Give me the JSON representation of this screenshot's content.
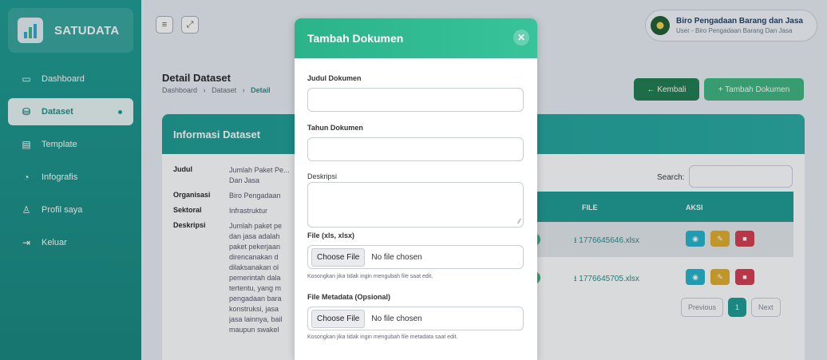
{
  "brand": {
    "name": "SATUDATA"
  },
  "sidebar": {
    "items": [
      {
        "label": "Dashboard",
        "icon": "monitor-icon"
      },
      {
        "label": "Dataset",
        "icon": "database-icon",
        "active": true
      },
      {
        "label": "Template",
        "icon": "document-icon"
      },
      {
        "label": "Infografis",
        "icon": "pie-chart-icon"
      },
      {
        "label": "Profil saya",
        "icon": "user-icon"
      },
      {
        "label": "Keluar",
        "icon": "logout-icon"
      }
    ]
  },
  "topbar": {
    "menu_icon": "≡",
    "expand_icon": "⤢",
    "profile": {
      "name": "Biro Pengadaan Barang dan Jasa",
      "role": "User - Biro Pengadaan Barang Dan Jasa"
    }
  },
  "page": {
    "title": "Detail Dataset",
    "breadcrumb": [
      "Dashboard",
      "Dataset",
      "Detail"
    ],
    "breadcrumb_sep": "›",
    "back_button": "← Kembali",
    "add_button": "+ Tambah Dokumen"
  },
  "info": {
    "header": "Informasi Dataset",
    "rows": [
      {
        "key": "Judul",
        "value": "Jumlah Paket Pe... Dan Jasa"
      },
      {
        "key": "Organisasi",
        "value": "Biro Pengadaan"
      },
      {
        "key": "Sektoral",
        "value": "Infrastruktur"
      },
      {
        "key": "Deskripsi",
        "value": "Jumlah paket pe dan jasa adalah paket pekerjaan direncanakan d dilaksanakan ol pemerintah dala tertentu, yang m pengadaan bara konstruksi, jasa jasa lainnya, bail maupun swakel"
      }
    ]
  },
  "table": {
    "search_label": "Search:",
    "columns": [
      "FILE",
      "AKSI"
    ],
    "rows": [
      {
        "file": "⭳ 1776645646.xlsx"
      },
      {
        "file": "⭳ 1776645705.xlsx"
      }
    ],
    "pager": {
      "prev": "Previous",
      "page": "1",
      "next": "Next"
    }
  },
  "modal": {
    "title": "Tambah Dokumen",
    "close": "✕",
    "fields": {
      "judul_label": "Judul Dokumen",
      "tahun_label": "Tahun Dokumen",
      "deskripsi_label": "Deskripsi",
      "file_label": "File (xls, xlsx)",
      "file_button": "Choose File",
      "file_status": "No file chosen",
      "file_hint": "Kosongkan jika tidak ingin mengubah file saat edit.",
      "meta_label": "File Metadata (Opsional)",
      "meta_button": "Choose File",
      "meta_status": "No file chosen",
      "meta_hint": "Kosongkan jika tidak ingin mengubah file metadata saat edit."
    }
  }
}
